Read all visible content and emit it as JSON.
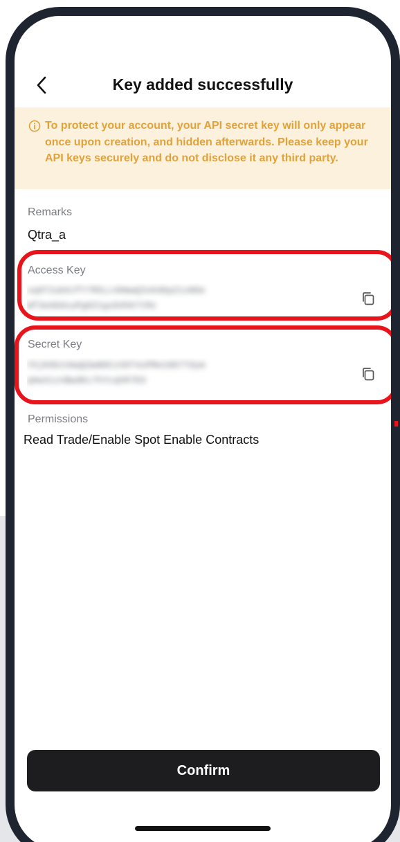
{
  "header": {
    "title": "Key added successfully"
  },
  "notice": {
    "text": "To protect your account, your API secret key will only appear once upon creation, and hidden afterwards. Please keep your API keys securely and do not disclose it any third party.",
    "color": "#e2a23a",
    "background": "#fbf1dc",
    "icon": "info-icon"
  },
  "remarks": {
    "label": "Remarks",
    "value": "Qtra_a"
  },
  "access_key": {
    "label": "Access Key",
    "icon": "copy-icon"
  },
  "secret_key": {
    "label": "Secret Key",
    "icon": "copy-icon"
  },
  "permissions": {
    "label": "Permissions",
    "value": "Read Trade/Enable Spot Enable Contracts"
  },
  "footer": {
    "confirm_label": "Confirm"
  },
  "colors": {
    "highlight": "#e8141c",
    "button": "#1d1d1f",
    "phone_frame": "#1e2530"
  }
}
